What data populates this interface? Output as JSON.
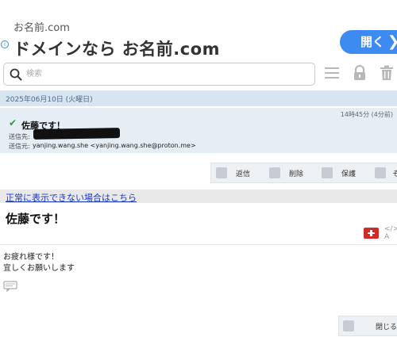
{
  "ad": {
    "small": "お名前.com",
    "big": "ドメインなら お名前.com",
    "button": "開く",
    "info": "i",
    "chevron": "❯"
  },
  "search": {
    "placeholder": "検索"
  },
  "toolbar": {
    "icons": [
      "menu-icon",
      "lock-icon",
      "trash-icon"
    ]
  },
  "date": "2025年06月10日 (火曜日)",
  "mail": {
    "subject": "佐藤です！",
    "time": "14時45分 (4分前)",
    "to_label": "送信先:",
    "from_label": "送信元:",
    "from_value": "yanjing.wang.she <yanjing.wang.she@proton.me>"
  },
  "actions": [
    {
      "label": "返信",
      "icon": "reply-icon"
    },
    {
      "label": "削除",
      "icon": "delete-icon"
    },
    {
      "label": "保護",
      "icon": "protect-icon"
    },
    {
      "label": "そ",
      "icon": "more-icon"
    }
  ],
  "link": "正常に表示できない場合はこちら",
  "body": {
    "subject": "佐藤です！",
    "lines": [
      "お疲れ様です！",
      "宜しくお願いします"
    ]
  },
  "close": {
    "label": "閉じる"
  },
  "colors": {
    "accent": "#3d8bf0",
    "date_bar": "#d8e4ef",
    "header_bg": "#e6eef5",
    "link": "#1a39c4"
  }
}
